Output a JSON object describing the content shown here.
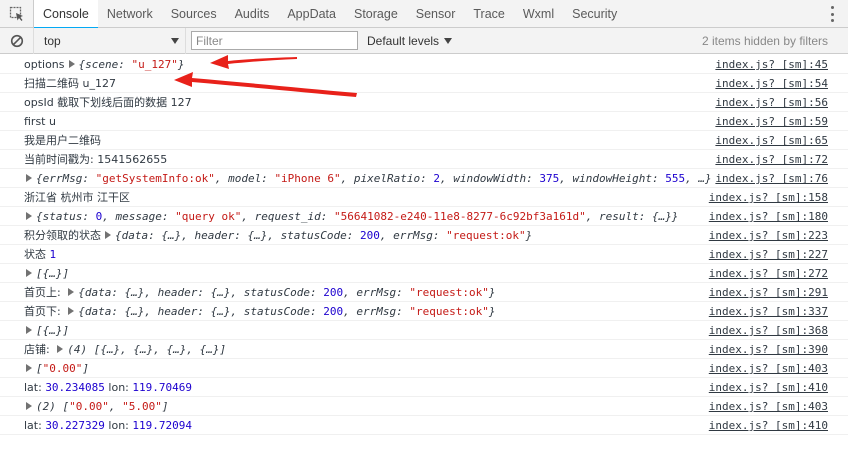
{
  "tabs": [
    "Console",
    "Network",
    "Sources",
    "Audits",
    "AppData",
    "Storage",
    "Sensor",
    "Trace",
    "Wxml",
    "Security"
  ],
  "toolbar": {
    "context": "top",
    "filter_placeholder": "Filter",
    "levels": "Default levels",
    "hidden": "2 items hidden by filters"
  },
  "rows": [
    {
      "parts": [
        [
          "t",
          "options"
        ],
        [
          "tri",
          ""
        ],
        [
          "o",
          "{scene: "
        ],
        [
          "s",
          "\"u_127\""
        ],
        [
          "o",
          "}"
        ]
      ],
      "src": "index.js? [sm]:45"
    },
    {
      "parts": [
        [
          "t",
          "扫描二维码 u_127"
        ]
      ],
      "src": "index.js? [sm]:54"
    },
    {
      "parts": [
        [
          "t",
          "opsId 截取下划线后面的数据 127"
        ]
      ],
      "src": "index.js? [sm]:56"
    },
    {
      "parts": [
        [
          "t",
          "first u"
        ]
      ],
      "src": "index.js? [sm]:59"
    },
    {
      "parts": [
        [
          "t",
          "我是用户二维码"
        ]
      ],
      "src": "index.js? [sm]:65"
    },
    {
      "parts": [
        [
          "t",
          "当前时间戳为: 1541562655"
        ]
      ],
      "src": "index.js? [sm]:72"
    },
    {
      "parts": [
        [
          "tri",
          ""
        ],
        [
          "o",
          "{errMsg: "
        ],
        [
          "s",
          "\"getSystemInfo:ok\""
        ],
        [
          "o",
          ", model: "
        ],
        [
          "s",
          "\"iPhone 6\""
        ],
        [
          "o",
          ", pixelRatio: "
        ],
        [
          "n",
          "2"
        ],
        [
          "o",
          ", windowWidth: "
        ],
        [
          "n",
          "375"
        ],
        [
          "o",
          ", windowHeight: "
        ],
        [
          "n",
          "555"
        ],
        [
          "o",
          ", …}"
        ]
      ],
      "src": "index.js? [sm]:76"
    },
    {
      "parts": [
        [
          "t",
          "浙江省 杭州市 江干区"
        ]
      ],
      "src": "index.js? [sm]:158"
    },
    {
      "parts": [
        [
          "tri",
          ""
        ],
        [
          "o",
          "{status: "
        ],
        [
          "n",
          "0"
        ],
        [
          "o",
          ", message: "
        ],
        [
          "s",
          "\"query ok\""
        ],
        [
          "o",
          ", request_id: "
        ],
        [
          "s",
          "\"56641082-e240-11e8-8277-6c92bf3a161d\""
        ],
        [
          "o",
          ", result: {…}}"
        ]
      ],
      "src": "index.js? [sm]:180"
    },
    {
      "parts": [
        [
          "t",
          "积分领取的状态"
        ],
        [
          "tri",
          ""
        ],
        [
          "o",
          "{data: {…}, header: {…}, statusCode: "
        ],
        [
          "n",
          "200"
        ],
        [
          "o",
          ", errMsg: "
        ],
        [
          "s",
          "\"request:ok\""
        ],
        [
          "o",
          "}"
        ]
      ],
      "src": "index.js? [sm]:223"
    },
    {
      "parts": [
        [
          "t",
          "状态 "
        ],
        [
          "n",
          "1"
        ]
      ],
      "src": "index.js? [sm]:227"
    },
    {
      "parts": [
        [
          "tri",
          ""
        ],
        [
          "o",
          "[{…}]"
        ]
      ],
      "src": "index.js? [sm]:272"
    },
    {
      "parts": [
        [
          "t",
          "首页上: "
        ],
        [
          "tri",
          ""
        ],
        [
          "o",
          "{data: {…}, header: {…}, statusCode: "
        ],
        [
          "n",
          "200"
        ],
        [
          "o",
          ", errMsg: "
        ],
        [
          "s",
          "\"request:ok\""
        ],
        [
          "o",
          "}"
        ]
      ],
      "src": "index.js? [sm]:291"
    },
    {
      "parts": [
        [
          "t",
          "首页下: "
        ],
        [
          "tri",
          ""
        ],
        [
          "o",
          "{data: {…}, header: {…}, statusCode: "
        ],
        [
          "n",
          "200"
        ],
        [
          "o",
          ", errMsg: "
        ],
        [
          "s",
          "\"request:ok\""
        ],
        [
          "o",
          "}"
        ]
      ],
      "src": "index.js? [sm]:337"
    },
    {
      "parts": [
        [
          "tri",
          ""
        ],
        [
          "o",
          "[{…}]"
        ]
      ],
      "src": "index.js? [sm]:368"
    },
    {
      "parts": [
        [
          "t",
          "店铺: "
        ],
        [
          "tri",
          ""
        ],
        [
          "o",
          "(4) [{…}, {…}, {…}, {…}]"
        ]
      ],
      "src": "index.js? [sm]:390"
    },
    {
      "parts": [
        [
          "tri",
          ""
        ],
        [
          "o",
          "["
        ],
        [
          "s",
          "\"0.00\""
        ],
        [
          "o",
          "]"
        ]
      ],
      "src": "index.js? [sm]:403"
    },
    {
      "parts": [
        [
          "t",
          "lat: "
        ],
        [
          "n",
          "30.234085"
        ],
        [
          "t",
          " lon: "
        ],
        [
          "n",
          "119.70469"
        ]
      ],
      "src": "index.js? [sm]:410"
    },
    {
      "parts": [
        [
          "tri",
          ""
        ],
        [
          "o",
          "(2) ["
        ],
        [
          "s",
          "\"0.00\""
        ],
        [
          "o",
          ", "
        ],
        [
          "s",
          "\"5.00\""
        ],
        [
          "o",
          "]"
        ]
      ],
      "src": "index.js? [sm]:403"
    },
    {
      "parts": [
        [
          "t",
          "lat: "
        ],
        [
          "n",
          "30.227329"
        ],
        [
          "t",
          " lon: "
        ],
        [
          "n",
          "119.72094"
        ]
      ],
      "src": "index.js? [sm]:410"
    }
  ],
  "colors": {
    "arrow": "#e8211a",
    "accent": "#03a9f4",
    "string": "#c41a16",
    "number": "#1c00cf"
  }
}
